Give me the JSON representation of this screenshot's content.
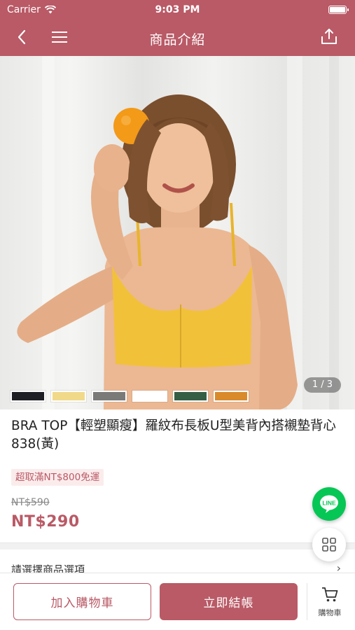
{
  "status_bar": {
    "carrier": "Carrier",
    "time": "9:03 PM"
  },
  "header": {
    "title": "商品介紹"
  },
  "icons": {
    "back": "chevron-left-icon",
    "menu": "hamburger-menu-icon",
    "share": "share-icon",
    "line": "line-chat-icon",
    "grid": "grid-icon",
    "cart": "shopping-cart-icon",
    "wifi": "wifi-icon",
    "battery": "battery-icon"
  },
  "gallery": {
    "counter": "1 / 3",
    "swatches": [
      "#1d1f24",
      "#f1d98a",
      "#7a7a78",
      "#ffffff",
      "#355e45",
      "#d98a2b"
    ]
  },
  "product": {
    "title": "BRA TOP【輕塑顯瘦】羅紋布長板U型美背內搭襯墊背心 838(黃)",
    "promo": "超取滿NT$800免運",
    "original_price": "NT$590",
    "price": "NT$290"
  },
  "options": {
    "label": "請選擇商品選項"
  },
  "fab": {
    "line_label": "LINE"
  },
  "bottom_bar": {
    "add_to_cart": "加入購物車",
    "checkout": "立即結帳",
    "cart_label": "購物車"
  },
  "colors": {
    "brand": "#b95a66",
    "line_green": "#06c755",
    "top_yellow": "#f2c13a"
  }
}
